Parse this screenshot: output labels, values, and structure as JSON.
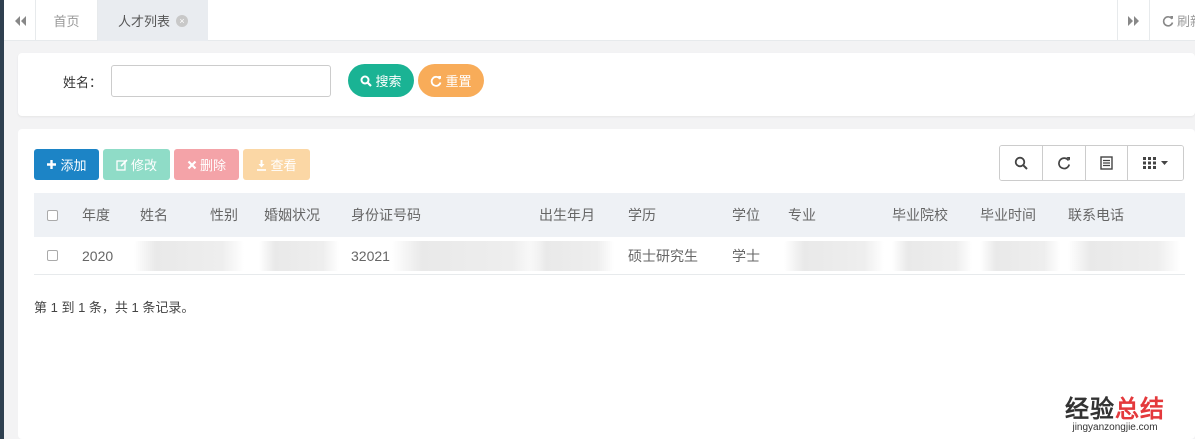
{
  "tabs": {
    "home": "首页",
    "active": "人才列表",
    "refresh": "刷新"
  },
  "search": {
    "name_label": "姓名：",
    "name_value": "",
    "search_label": "搜索",
    "reset_label": "重置"
  },
  "toolbar": {
    "add_label": "添加",
    "edit_label": "修改",
    "delete_label": "删除",
    "view_label": "查看"
  },
  "table": {
    "headers": [
      "年度",
      "姓名",
      "性别",
      "婚姻状况",
      "身份证号码",
      "出生年月",
      "学历",
      "学位",
      "专业",
      "毕业院校",
      "毕业时间",
      "联系电话"
    ],
    "rows": [
      {
        "year": "2020",
        "id_number": "32021",
        "education": "硕士研究生",
        "degree": "学士"
      }
    ]
  },
  "pagination": {
    "summary": "第 1 到 1 条，共 1 条记录。"
  },
  "watermark": {
    "text_dark": "经验",
    "text_red": "总结",
    "url": "jingyanzongjie.com"
  },
  "colors": {
    "primary": "#1c84c6",
    "success": "#1ab394",
    "warning": "#f8ac59",
    "danger": "#ed5565",
    "sidebar": "#2f4050"
  },
  "icons": {
    "tab_left": "double-chevron-left-icon",
    "tab_right": "double-chevron-right-icon",
    "refresh": "refresh-icon",
    "search": "search-icon",
    "reset": "refresh-icon",
    "add": "plus-icon",
    "edit": "edit-icon",
    "delete": "close-icon",
    "view": "download-icon",
    "columns": "grid-icon"
  }
}
